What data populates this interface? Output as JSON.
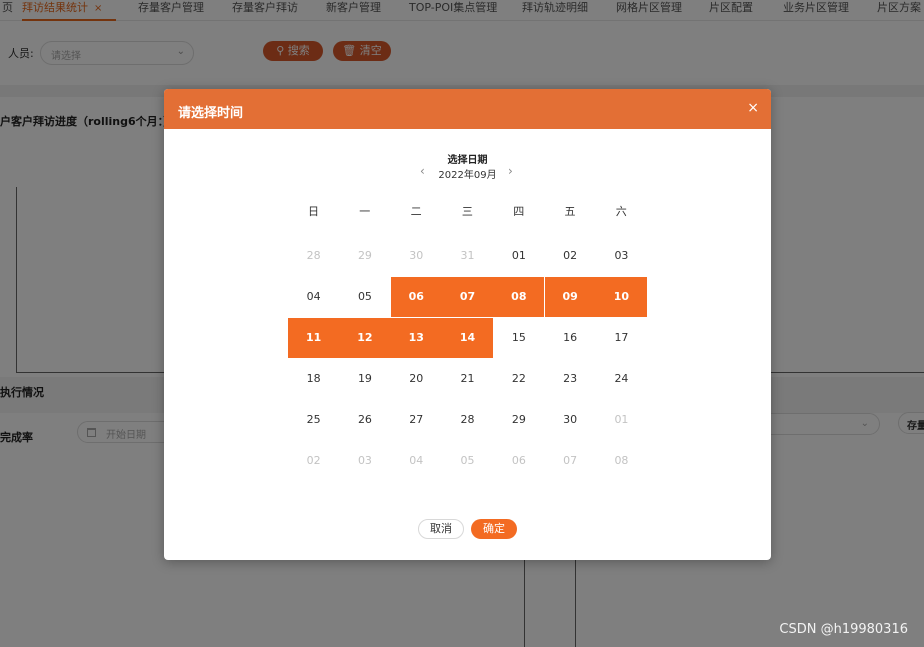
{
  "tabs": [
    {
      "label": "页"
    },
    {
      "label": "拜访结果统计",
      "close": "×"
    },
    {
      "label": "存量客户管理"
    },
    {
      "label": "存量客户拜访"
    },
    {
      "label": "新客户管理"
    },
    {
      "label": "TOP-POI集点管理"
    },
    {
      "label": "拜访轨迹明细"
    },
    {
      "label": "网格片区管理"
    },
    {
      "label": "片区配置"
    },
    {
      "label": "业务片区管理"
    },
    {
      "label": "片区方案"
    }
  ],
  "filters": {
    "person_label": "人员:",
    "person_placeholder": "请选择",
    "search_label": "搜索",
    "clear_label": "清空"
  },
  "sections": {
    "progress_title": "户客户拜访进度（rolling6个月：）",
    "execution_title": "执行情况",
    "completion_label": "完成率",
    "start_date_placeholder": "开始日期",
    "right_button_label": "存量"
  },
  "modal": {
    "title": "请选择时间",
    "close": "×",
    "picker_title": "选择日期",
    "month_label": "2022年09月",
    "prev": "‹",
    "next": "›",
    "weekdays": [
      "日",
      "一",
      "二",
      "三",
      "四",
      "五",
      "六"
    ],
    "weeks": [
      [
        {
          "d": "28",
          "m": 1
        },
        {
          "d": "29",
          "m": 1
        },
        {
          "d": "30",
          "m": 1
        },
        {
          "d": "31",
          "m": 1
        },
        {
          "d": "01",
          "m": 0
        },
        {
          "d": "02",
          "m": 0
        },
        {
          "d": "03",
          "m": 0
        }
      ],
      [
        {
          "d": "04",
          "m": 0
        },
        {
          "d": "05",
          "m": 0
        },
        {
          "d": "06",
          "s": 1
        },
        {
          "d": "07",
          "s": 1
        },
        {
          "d": "08",
          "s": 1
        },
        {
          "d": "09",
          "s": 1
        },
        {
          "d": "10",
          "s": 1
        }
      ],
      [
        {
          "d": "11",
          "s": 1
        },
        {
          "d": "12",
          "s": 1
        },
        {
          "d": "13",
          "s": 1
        },
        {
          "d": "14",
          "s": 1
        },
        {
          "d": "15",
          "m": 0
        },
        {
          "d": "16",
          "m": 0
        },
        {
          "d": "17",
          "m": 0
        }
      ],
      [
        {
          "d": "18",
          "m": 0
        },
        {
          "d": "19",
          "m": 0
        },
        {
          "d": "20",
          "m": 0
        },
        {
          "d": "21",
          "m": 0
        },
        {
          "d": "22",
          "m": 0
        },
        {
          "d": "23",
          "m": 0
        },
        {
          "d": "24",
          "m": 0
        }
      ],
      [
        {
          "d": "25",
          "m": 0
        },
        {
          "d": "26",
          "m": 0
        },
        {
          "d": "27",
          "m": 0
        },
        {
          "d": "28",
          "m": 0
        },
        {
          "d": "29",
          "m": 0
        },
        {
          "d": "30",
          "m": 0
        },
        {
          "d": "01",
          "m": 1
        }
      ],
      [
        {
          "d": "02",
          "m": 1
        },
        {
          "d": "03",
          "m": 1
        },
        {
          "d": "04",
          "m": 1
        },
        {
          "d": "05",
          "m": 1
        },
        {
          "d": "06",
          "m": 1
        },
        {
          "d": "07",
          "m": 1
        },
        {
          "d": "08",
          "m": 1
        }
      ]
    ],
    "selected_range": "2022-09-06 to 2022-09-14",
    "cancel_label": "取消",
    "confirm_label": "确定"
  },
  "watermark": "CSDN @h19980316",
  "colors": {
    "accent": "#f36b22",
    "header": "#e36f35",
    "muted_day": "#c3c3c3"
  }
}
